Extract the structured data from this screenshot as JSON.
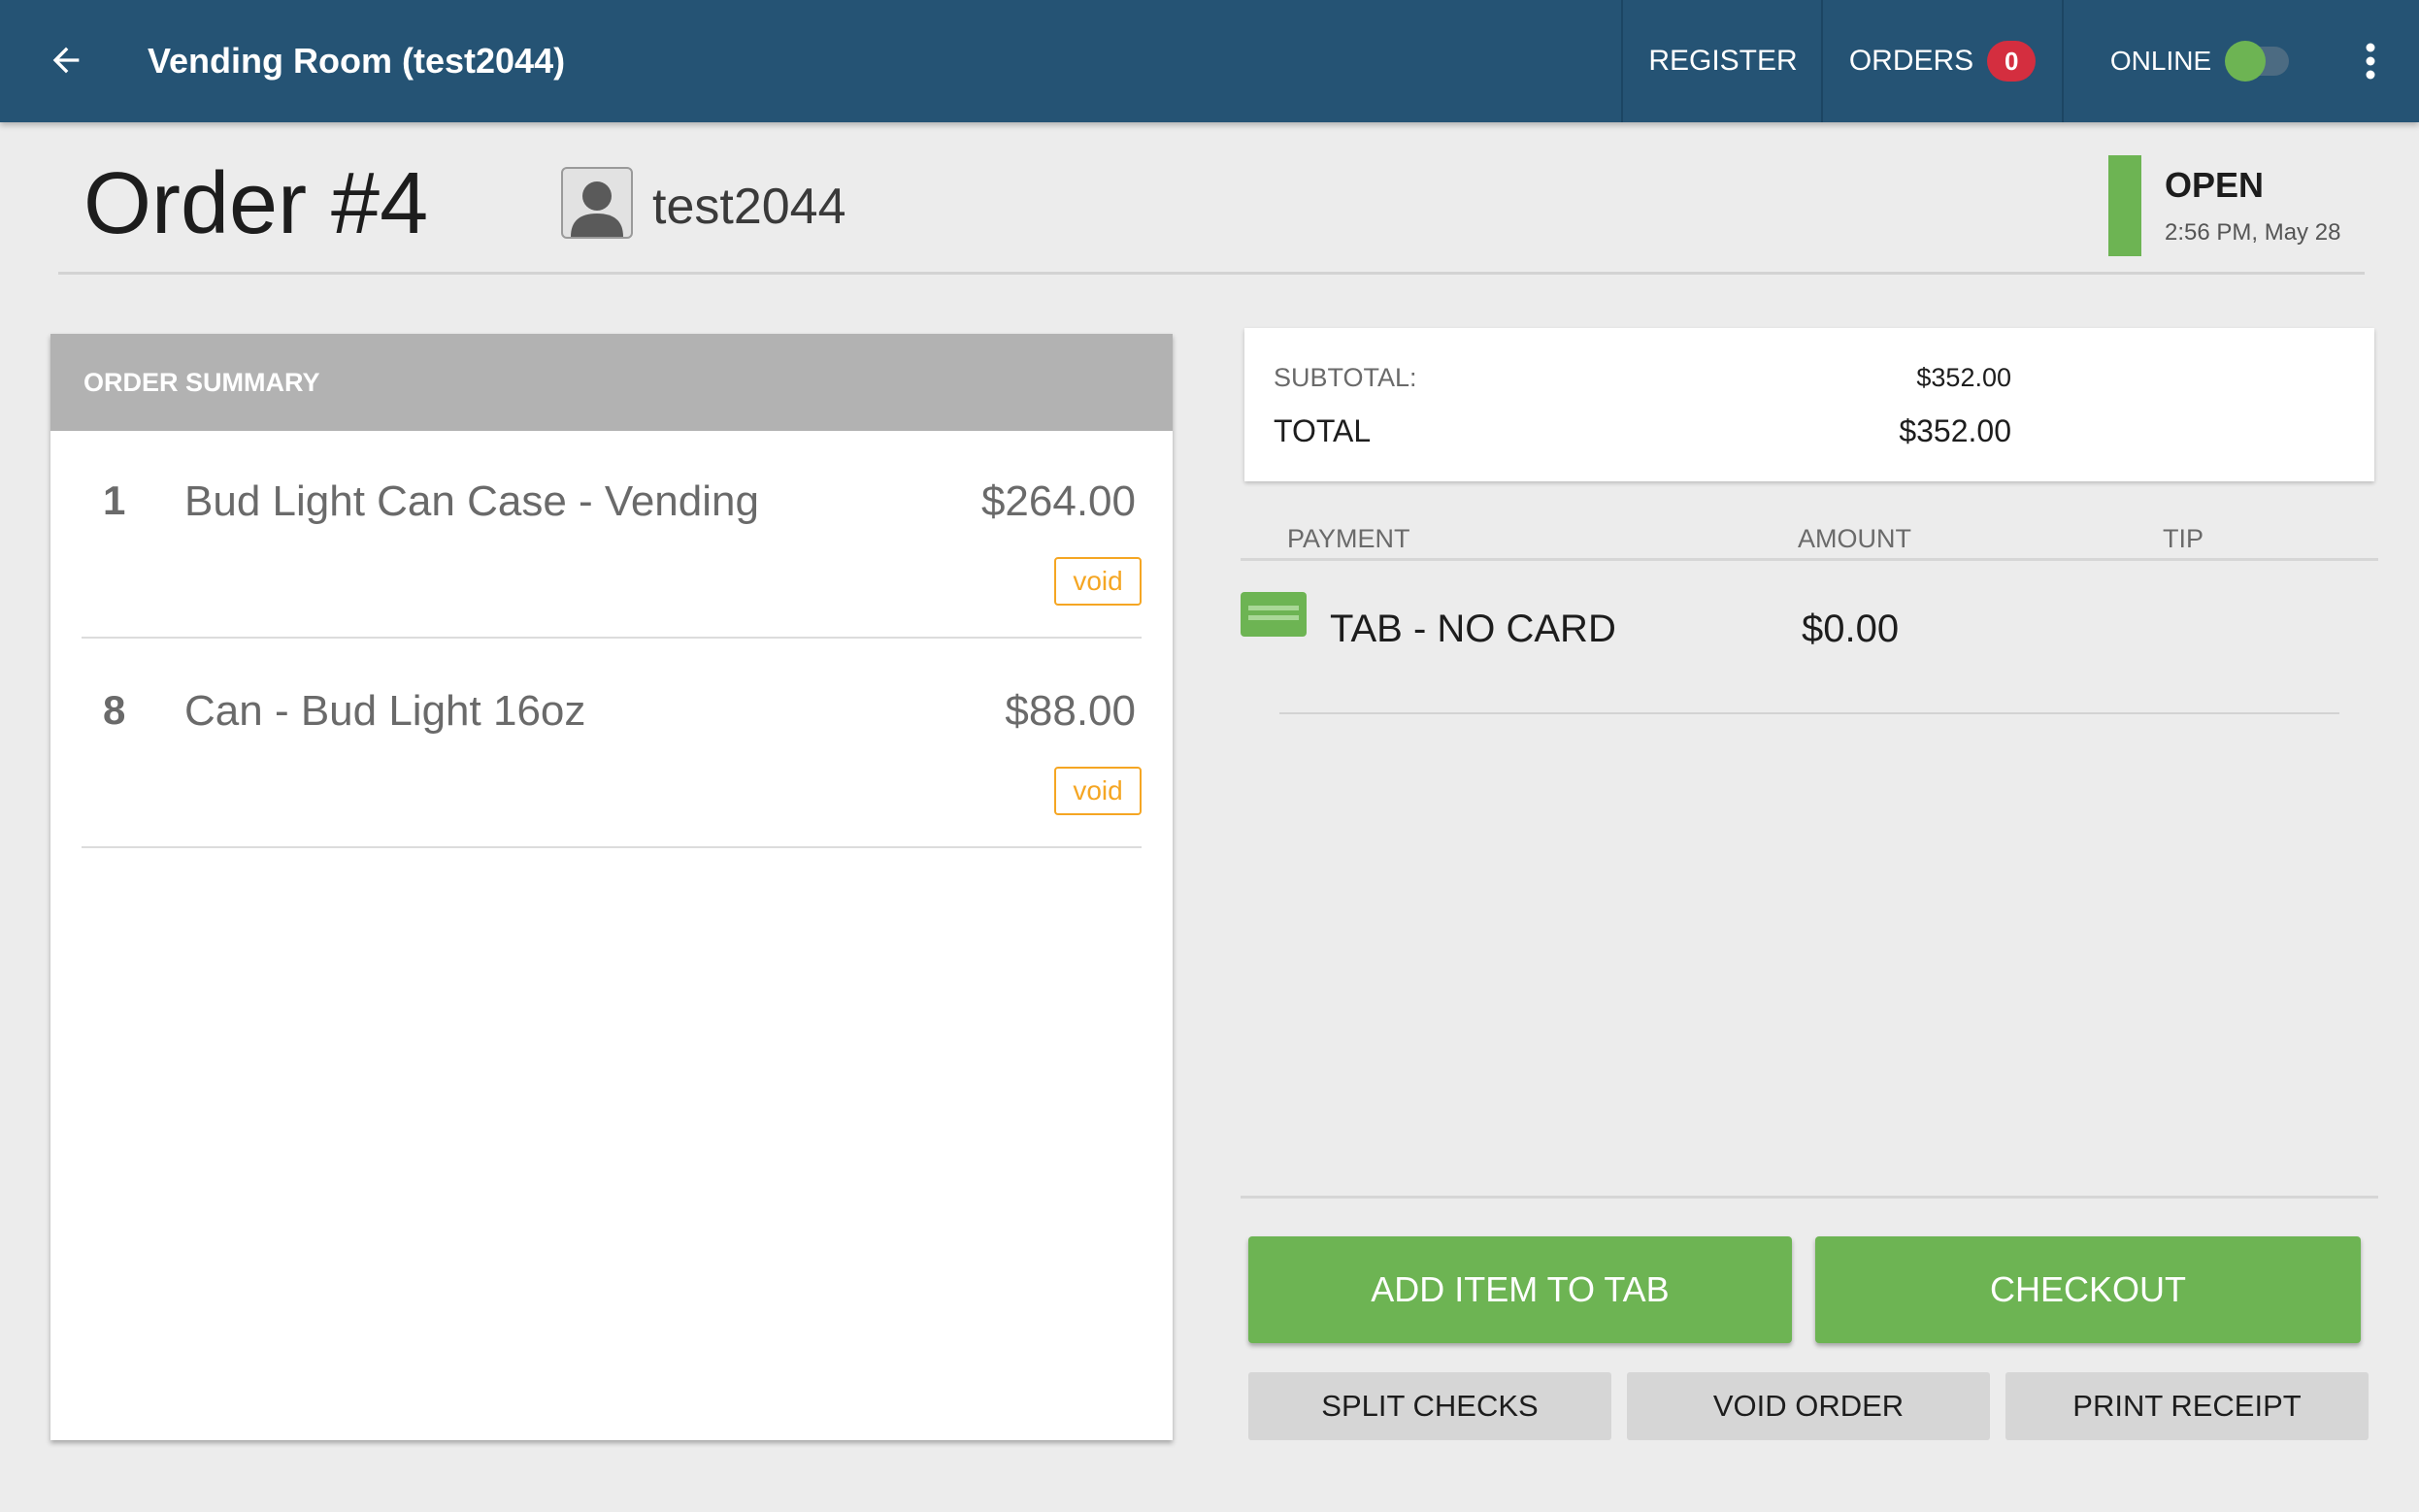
{
  "topbar": {
    "back_icon": "arrow-left-icon",
    "title": "Vending Room (test2044)",
    "register_label": "REGISTER",
    "orders_label": "ORDERS",
    "orders_count": "0",
    "online_label": "ONLINE",
    "online_toggle_on": true,
    "overflow_icon": "more-vertical-icon"
  },
  "order": {
    "title": "Order #4",
    "customer_name": "test2044",
    "customer_icon": "user-avatar-icon",
    "status": "OPEN",
    "status_time": "2:56 PM, May 28",
    "status_color": "#6db453"
  },
  "summary": {
    "header": "ORDER SUMMARY",
    "items": [
      {
        "qty": "1",
        "name": "Bud Light Can Case - Vending",
        "price": "$264.00",
        "void_label": "void"
      },
      {
        "qty": "8",
        "name": "Can - Bud Light 16oz",
        "price": "$88.00",
        "void_label": "void"
      }
    ]
  },
  "totals": {
    "subtotal_label": "SUBTOTAL:",
    "subtotal_value": "$352.00",
    "total_label": "TOTAL",
    "total_value": "$352.00"
  },
  "payments": {
    "headers": {
      "payment": "PAYMENT",
      "amount": "AMOUNT",
      "tip": "TIP"
    },
    "rows": [
      {
        "icon": "credit-card-icon",
        "method": "TAB - NO CARD",
        "amount": "$0.00",
        "tip": ""
      }
    ]
  },
  "actions": {
    "add_item": "ADD ITEM TO TAB",
    "checkout": "CHECKOUT",
    "split_checks": "SPLIT CHECKS",
    "void_order": "VOID ORDER",
    "print_receipt": "PRINT RECEIPT"
  },
  "colors": {
    "topbar": "#255374",
    "accent_green": "#6db453",
    "badge_red": "#d42e3f",
    "void_orange": "#f5a623"
  }
}
